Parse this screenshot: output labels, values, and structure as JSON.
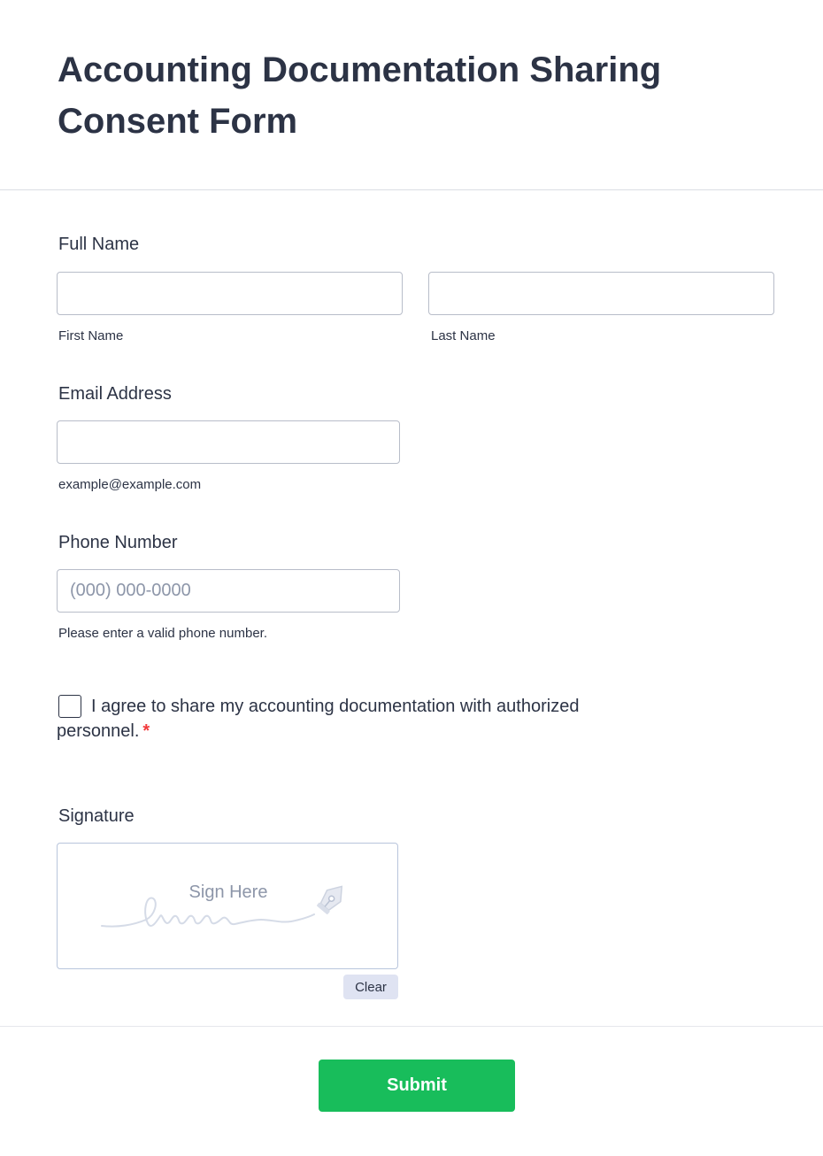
{
  "form": {
    "title": "Accounting Documentation Sharing Consent Form"
  },
  "full_name": {
    "label": "Full Name",
    "first_value": "",
    "first_sublabel": "First Name",
    "last_value": "",
    "last_sublabel": "Last Name"
  },
  "email": {
    "label": "Email Address",
    "value": "",
    "sublabel": "example@example.com"
  },
  "phone": {
    "label": "Phone Number",
    "value": "",
    "placeholder": "(000) 000-0000",
    "sublabel": "Please enter a valid phone number."
  },
  "consent": {
    "text": "I agree to share my accounting documentation with authorized personnel.",
    "required_mark": "*",
    "checked": false
  },
  "signature": {
    "label": "Signature",
    "placeholder": "Sign Here",
    "clear_label": "Clear",
    "icon": "pen-nib-icon"
  },
  "submit": {
    "label": "Submit"
  },
  "colors": {
    "text": "#2c3345",
    "submit_bg": "#18bd5b",
    "required": "#f23a3c",
    "clear_bg": "#dfe3f2",
    "input_border": "#b8bdc9"
  }
}
